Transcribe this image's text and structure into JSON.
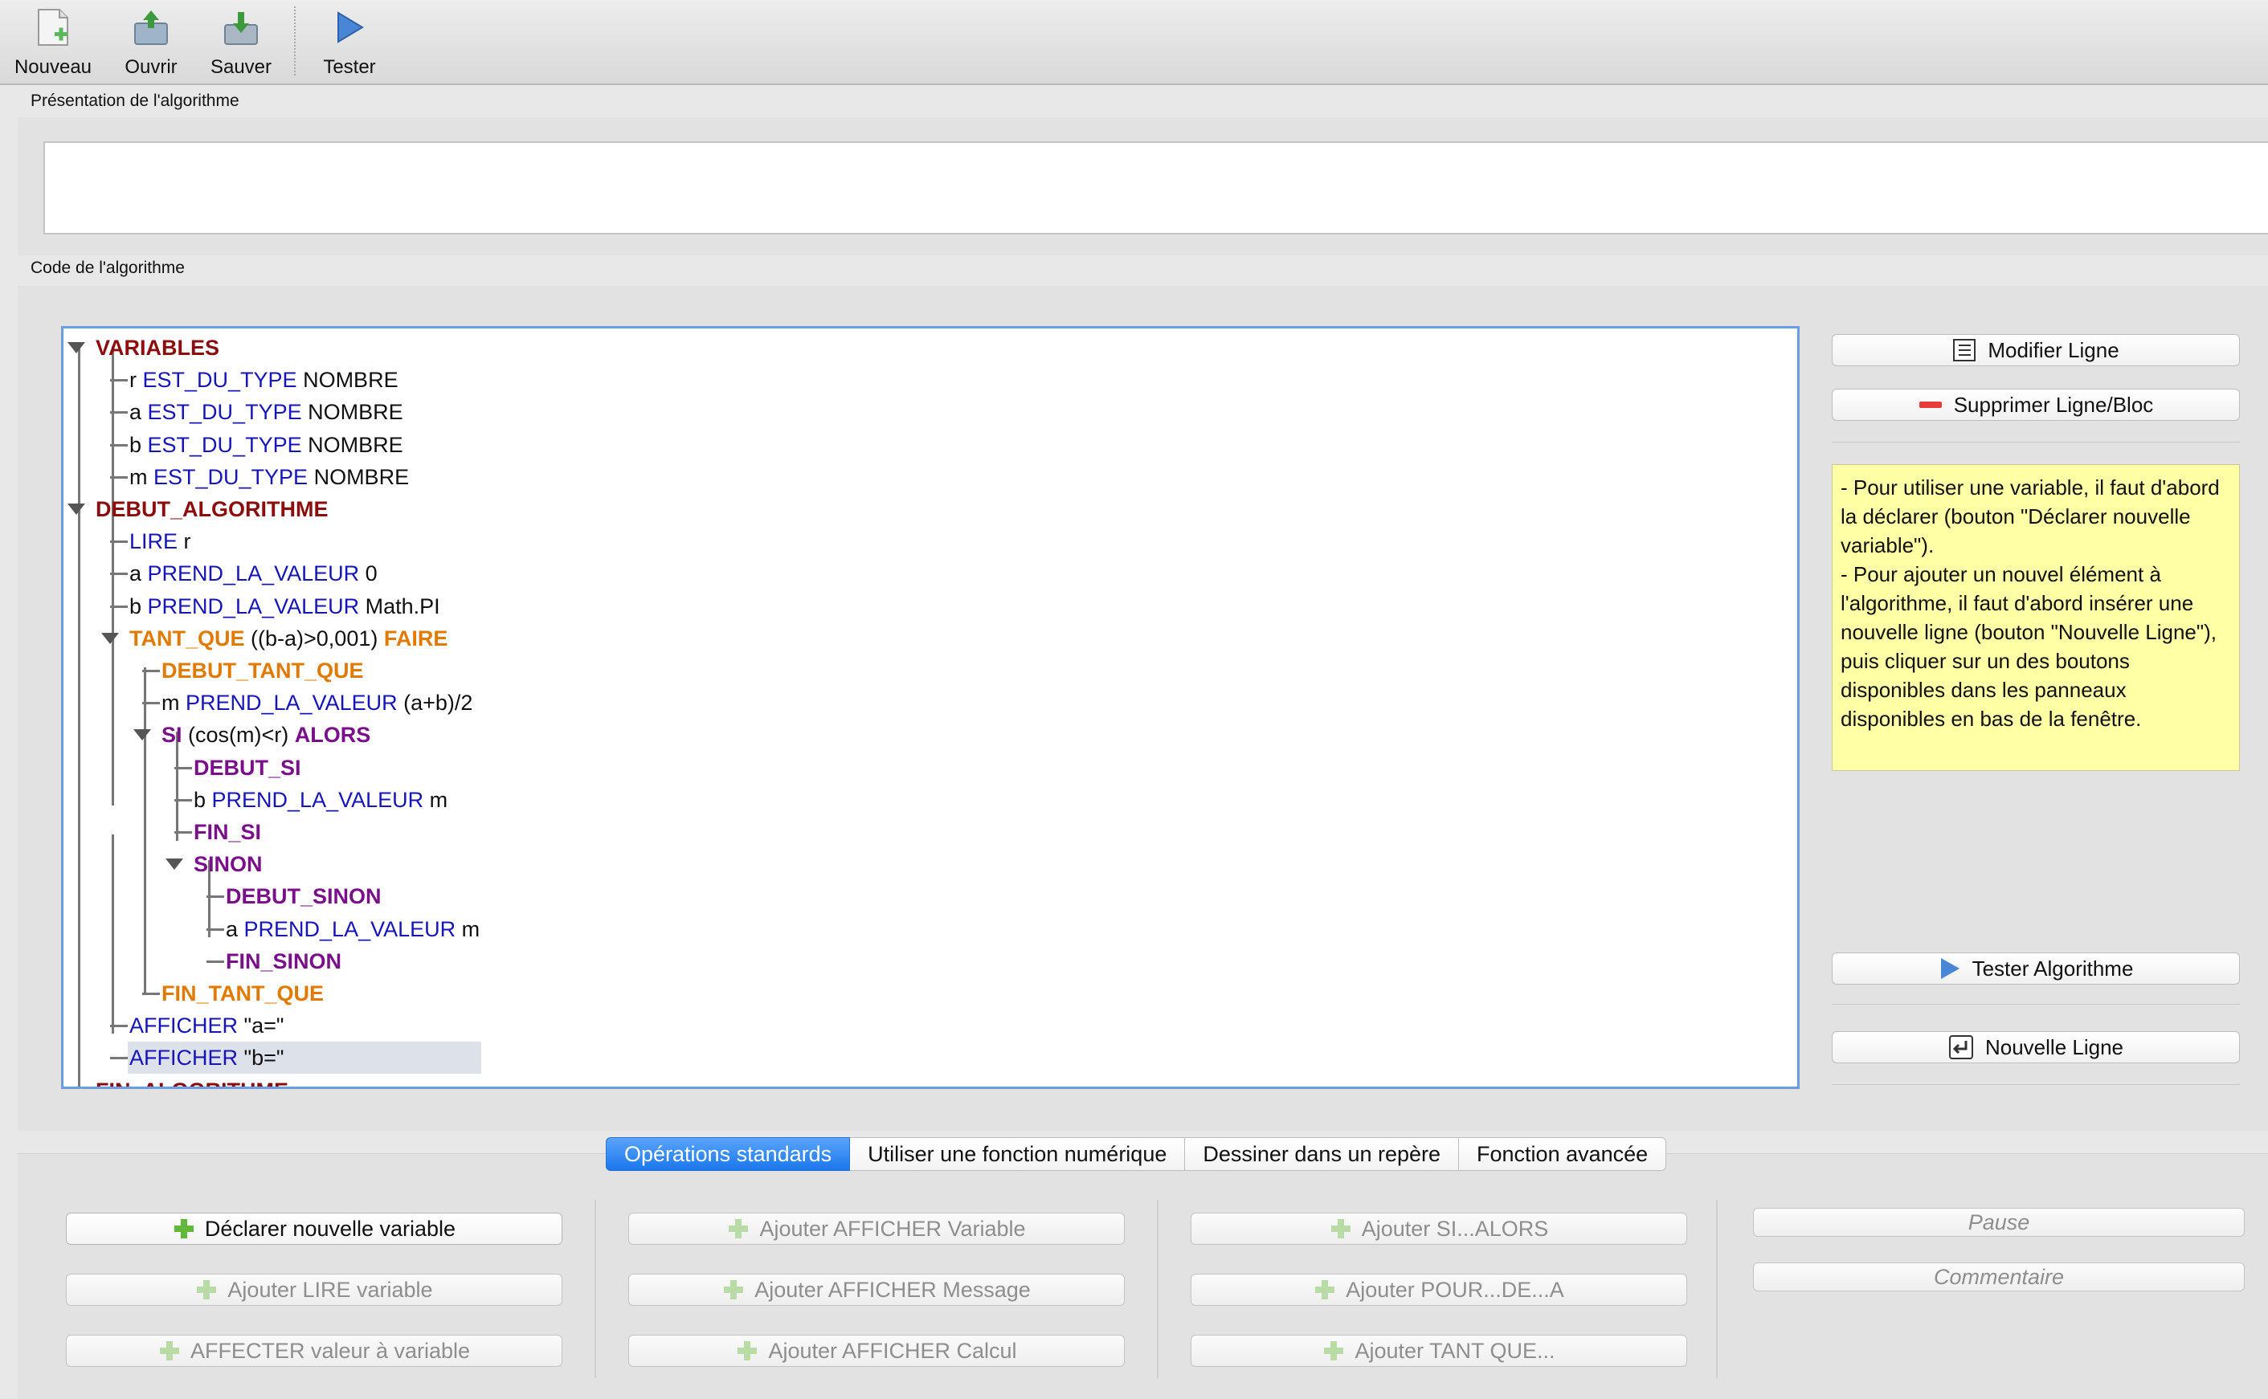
{
  "toolbar": {
    "new_label": "Nouveau",
    "open_label": "Ouvrir",
    "save_label": "Sauver",
    "test_label": "Tester"
  },
  "presentation": {
    "label": "Présentation de l'algorithme",
    "text": ""
  },
  "code": {
    "label": "Code de l'algorithme"
  },
  "tree": {
    "rows": [
      [
        {
          "t": "VARIABLES",
          "c": "kw-var"
        }
      ],
      [
        {
          "t": "r ",
          "c": "txt"
        },
        {
          "t": "EST_DU_TYPE",
          "c": "kw-blue"
        },
        {
          "t": " NOMBRE",
          "c": "txt"
        }
      ],
      [
        {
          "t": "a ",
          "c": "txt"
        },
        {
          "t": "EST_DU_TYPE",
          "c": "kw-blue"
        },
        {
          "t": " NOMBRE",
          "c": "txt"
        }
      ],
      [
        {
          "t": "b ",
          "c": "txt"
        },
        {
          "t": "EST_DU_TYPE",
          "c": "kw-blue"
        },
        {
          "t": " NOMBRE",
          "c": "txt"
        }
      ],
      [
        {
          "t": "m ",
          "c": "txt"
        },
        {
          "t": "EST_DU_TYPE",
          "c": "kw-blue"
        },
        {
          "t": " NOMBRE",
          "c": "txt"
        }
      ],
      [
        {
          "t": "DEBUT_ALGORITHME",
          "c": "kw-var"
        }
      ],
      [
        {
          "t": "LIRE",
          "c": "kw-blue"
        },
        {
          "t": " r",
          "c": "txt"
        }
      ],
      [
        {
          "t": "a ",
          "c": "txt"
        },
        {
          "t": "PREND_LA_VALEUR",
          "c": "kw-blue"
        },
        {
          "t": " 0",
          "c": "txt"
        }
      ],
      [
        {
          "t": "b ",
          "c": "txt"
        },
        {
          "t": "PREND_LA_VALEUR",
          "c": "kw-blue"
        },
        {
          "t": " Math.PI",
          "c": "txt"
        }
      ],
      [
        {
          "t": "TANT_QUE",
          "c": "kw-orange"
        },
        {
          "t": " ((b-a)>0,001) ",
          "c": "txt"
        },
        {
          "t": "FAIRE",
          "c": "kw-orange"
        }
      ],
      [
        {
          "t": "DEBUT_TANT_QUE",
          "c": "kw-orange"
        }
      ],
      [
        {
          "t": "m ",
          "c": "txt"
        },
        {
          "t": "PREND_LA_VALEUR",
          "c": "kw-blue"
        },
        {
          "t": " (a+b)/2",
          "c": "txt"
        }
      ],
      [
        {
          "t": "SI",
          "c": "kw-purple"
        },
        {
          "t": " (cos(m)<r) ",
          "c": "txt"
        },
        {
          "t": "ALORS",
          "c": "kw-purple"
        }
      ],
      [
        {
          "t": "DEBUT_SI",
          "c": "kw-purple"
        }
      ],
      [
        {
          "t": "b ",
          "c": "txt"
        },
        {
          "t": "PREND_LA_VALEUR",
          "c": "kw-blue"
        },
        {
          "t": " m",
          "c": "txt"
        }
      ],
      [
        {
          "t": "FIN_SI",
          "c": "kw-purple"
        }
      ],
      [
        {
          "t": "SINON",
          "c": "kw-purple"
        }
      ],
      [
        {
          "t": "DEBUT_SINON",
          "c": "kw-purple"
        }
      ],
      [
        {
          "t": "a ",
          "c": "txt"
        },
        {
          "t": "PREND_LA_VALEUR",
          "c": "kw-blue"
        },
        {
          "t": " m",
          "c": "txt"
        }
      ],
      [
        {
          "t": "FIN_SINON",
          "c": "kw-purple"
        }
      ],
      [
        {
          "t": "FIN_TANT_QUE",
          "c": "kw-orange"
        }
      ],
      [
        {
          "t": "AFFICHER",
          "c": "kw-blue"
        },
        {
          "t": " \"a=\"",
          "c": "txt"
        }
      ],
      [
        {
          "t": "AFFICHER",
          "c": "kw-blue"
        },
        {
          "t": " \"b=\"",
          "c": "txt"
        }
      ],
      [
        {
          "t": "FIN_ALGORITHME",
          "c": "kw-var"
        }
      ]
    ]
  },
  "side": {
    "modify_label": "Modifier Ligne",
    "delete_label": "Supprimer Ligne/Bloc",
    "help_lines": [
      "- Pour utiliser une variable, il faut d'abord la déclarer (bouton \"Déclarer nouvelle variable\").",
      "- Pour ajouter un nouvel élément à l'algorithme, il faut d'abord insérer une nouvelle ligne (bouton \"Nouvelle Ligne\"), puis cliquer sur un des boutons disponibles dans les panneaux disponibles en bas de la fenêtre."
    ],
    "test_label": "Tester Algorithme",
    "newline_label": "Nouvelle Ligne"
  },
  "tabs": [
    "Opérations standards",
    "Utiliser une fonction numérique",
    "Dessiner dans un repère",
    "Fonction avancée"
  ],
  "ops": {
    "declare": "Déclarer nouvelle variable",
    "lire": "Ajouter LIRE variable",
    "affecter": "AFFECTER valeur à variable",
    "aff_var": "Ajouter AFFICHER Variable",
    "aff_msg": "Ajouter AFFICHER Message",
    "aff_calc": "Ajouter AFFICHER Calcul",
    "si": "Ajouter SI...ALORS",
    "pour": "Ajouter POUR...DE...A",
    "tantque": "Ajouter TANT QUE...",
    "pause": "Pause",
    "comment": "Commentaire"
  },
  "colors": {
    "accent": "#1a77ec",
    "tree_border": "#6a9ee2",
    "help_bg": "#ffffa6"
  }
}
